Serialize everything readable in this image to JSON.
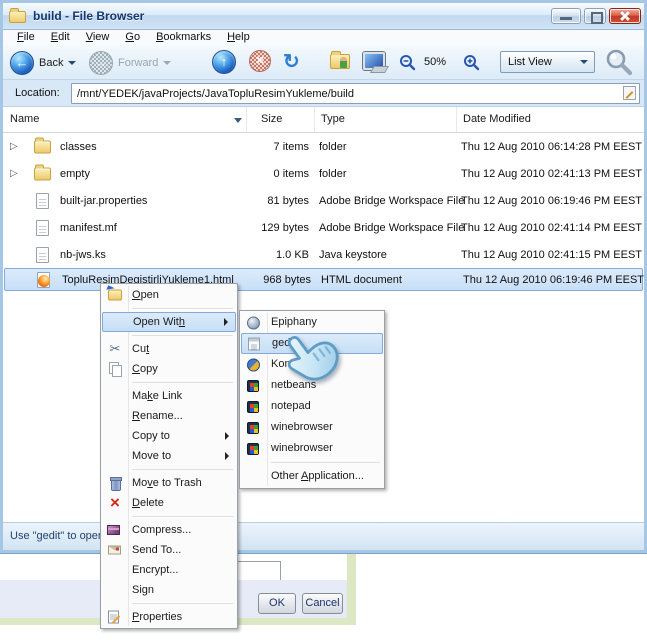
{
  "window": {
    "title": "build - File Browser"
  },
  "menubar": {
    "items": [
      {
        "label": "File",
        "accel": 0
      },
      {
        "label": "Edit",
        "accel": 0
      },
      {
        "label": "View",
        "accel": 0
      },
      {
        "label": "Go",
        "accel": 0
      },
      {
        "label": "Bookmarks",
        "accel": 0
      },
      {
        "label": "Help",
        "accel": 0
      }
    ]
  },
  "toolbar": {
    "back_label": "Back",
    "forward_label": "Forward",
    "zoom_level": "50%",
    "view_mode": "List View"
  },
  "location": {
    "label": "Location:",
    "value": "/mnt/YEDEK/javaProjects/JavaTopluResimYukleme/build"
  },
  "filelist": {
    "columns": [
      "Name",
      "Size",
      "Type",
      "Date Modified"
    ],
    "sort_column": "Name",
    "sort_direction": "descending",
    "rows": [
      {
        "name": "classes",
        "size": "7 items",
        "type": "folder",
        "date": "Thu 12 Aug 2010 06:14:28 PM EEST",
        "icon": "folder",
        "expander": true,
        "selected": false
      },
      {
        "name": "empty",
        "size": "0 items",
        "type": "folder",
        "date": "Thu 12 Aug 2010 02:41:13 PM EEST",
        "icon": "folder",
        "expander": true,
        "selected": false
      },
      {
        "name": "built-jar.properties",
        "size": "81 bytes",
        "type": "Adobe Bridge Workspace File",
        "date": "Thu 12 Aug 2010 06:19:46 PM EEST",
        "icon": "file",
        "expander": false,
        "selected": false
      },
      {
        "name": "manifest.mf",
        "size": "129 bytes",
        "type": "Adobe Bridge Workspace File",
        "date": "Thu 12 Aug 2010 02:41:14 PM EEST",
        "icon": "file",
        "expander": false,
        "selected": false
      },
      {
        "name": "nb-jws.ks",
        "size": "1.0 KB",
        "type": "Java keystore",
        "date": "Thu 12 Aug 2010 02:41:15 PM EEST",
        "icon": "file",
        "expander": false,
        "selected": false
      },
      {
        "name": "TopluResimDegistirliYukleme1.html",
        "size": "968 bytes",
        "type": "HTML document",
        "date": "Thu 12 Aug 2010 06:19:46 PM EEST",
        "icon": "firefox",
        "expander": false,
        "selected": true
      }
    ]
  },
  "statusbar": {
    "text": "Use \"gedit\" to open"
  },
  "context_menu": {
    "items": [
      {
        "label": "Open",
        "accel": 0,
        "icon": "open",
        "name": "context-menu-open"
      },
      {
        "type": "sep"
      },
      {
        "label": "Open With",
        "accel": 8,
        "submenu": true,
        "highlighted": true,
        "name": "context-menu-open-with"
      },
      {
        "type": "sep"
      },
      {
        "label": "Cut",
        "accel": 2,
        "icon": "cut",
        "name": "context-menu-cut"
      },
      {
        "label": "Copy",
        "accel": 0,
        "icon": "copy",
        "name": "context-menu-copy"
      },
      {
        "type": "sep"
      },
      {
        "label": "Make Link",
        "accel": 2,
        "name": "context-menu-make-link"
      },
      {
        "label": "Rename...",
        "accel": 0,
        "name": "context-menu-rename"
      },
      {
        "label": "Copy to",
        "submenu": true,
        "name": "context-menu-copy-to"
      },
      {
        "label": "Move to",
        "submenu": true,
        "name": "context-menu-move-to"
      },
      {
        "type": "sep"
      },
      {
        "label": "Move to Trash",
        "accel": 2,
        "icon": "trash",
        "name": "context-menu-move-to-trash"
      },
      {
        "label": "Delete",
        "accel": 0,
        "icon": "delete",
        "name": "context-menu-delete"
      },
      {
        "type": "sep"
      },
      {
        "label": "Compress...",
        "icon": "compress",
        "name": "context-menu-compress"
      },
      {
        "label": "Send To...",
        "icon": "sendto",
        "name": "context-menu-send-to"
      },
      {
        "label": "Encrypt...",
        "name": "context-menu-encrypt"
      },
      {
        "label": "Sign",
        "name": "context-menu-sign"
      },
      {
        "type": "sep"
      },
      {
        "label": "Properties",
        "accel": 0,
        "icon": "props",
        "name": "context-menu-properties"
      }
    ]
  },
  "open_with_submenu": {
    "items": [
      {
        "label": "Epiphany",
        "icon": "epiphany",
        "name": "open-with-epiphany"
      },
      {
        "label": "gedit",
        "icon": "gedit",
        "highlighted": true,
        "name": "open-with-gedit"
      },
      {
        "label": "KompoZer",
        "icon": "kompozer",
        "name": "open-with-kompozer"
      },
      {
        "label": "netbeans",
        "icon": "winflag",
        "name": "open-with-netbeans"
      },
      {
        "label": "notepad",
        "icon": "winflag",
        "name": "open-with-notepad"
      },
      {
        "label": "winebrowser",
        "icon": "winflag",
        "name": "open-with-winebrowser-1"
      },
      {
        "label": "winebrowser",
        "icon": "winflag",
        "name": "open-with-winebrowser-2"
      },
      {
        "type": "sep"
      },
      {
        "label": "Other Application...",
        "accel": 6,
        "name": "open-with-other-application"
      }
    ]
  },
  "background_dialog": {
    "ok_label": "OK",
    "cancel_label": "Cancel"
  },
  "colors": {
    "selection_highlight": "#c6dff7",
    "menu_highlight": "#cde3f8",
    "titlebar_text": "#15366e",
    "close_button_red": "#c03a28",
    "dialog_panel_lavender": "#e7ebf7",
    "dialog_border_green": "#dce7c3",
    "accent_blue": "#1858b8"
  }
}
